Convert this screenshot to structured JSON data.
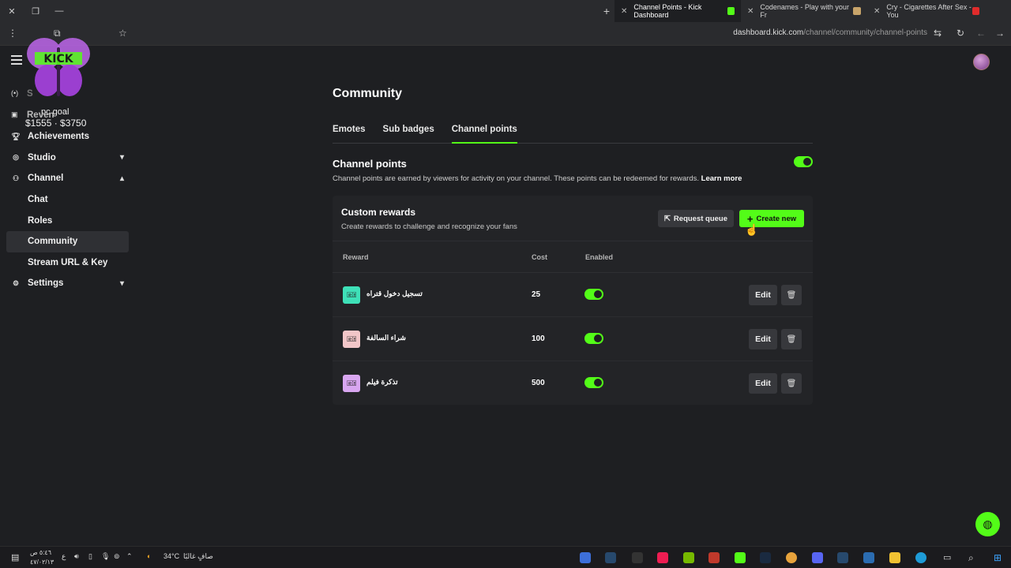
{
  "browser": {
    "tabs": [
      {
        "title": "Channel Points - Kick Dashboard",
        "active": true,
        "fav_color": "#53fc18"
      },
      {
        "title": "Codenames - Play with your Fr",
        "active": false,
        "fav_color": "#c8a46a"
      },
      {
        "title": "Cry - Cigarettes After Sex - You",
        "active": false,
        "fav_color": "#e02b2b"
      }
    ],
    "url_host": "dashboard.kick.com",
    "url_path": "/channel/community/channel-points"
  },
  "overlay": {
    "goal_label": "pc goal",
    "goal_values": "$1555 · $3750"
  },
  "sidebar": {
    "items": [
      {
        "label": "Achievements",
        "icon": "trophy-icon"
      },
      {
        "label": "Studio",
        "icon": "studio-icon"
      },
      {
        "label": "Channel",
        "icon": "channel-icon"
      },
      {
        "label": "Chat"
      },
      {
        "label": "Roles"
      },
      {
        "label": "Community"
      },
      {
        "label": "Stream URL & Key"
      },
      {
        "label": "Settings",
        "icon": "gear-icon"
      }
    ],
    "partial_items": [
      "S",
      "Reven"
    ]
  },
  "page": {
    "title": "Community",
    "tabs": [
      "Emotes",
      "Sub badges",
      "Channel points"
    ],
    "channel_points": {
      "title": "Channel points",
      "description": "Channel points are earned by viewers for activity on your channel. These points can be redeemed for rewards.",
      "learn_more": "Learn more",
      "enabled": true
    },
    "custom_rewards": {
      "title": "Custom rewards",
      "subtitle": "Create rewards to challenge and recognize your fans",
      "request_queue_label": "Request queue",
      "create_new_label": "Create new",
      "columns": [
        "Reward",
        "Cost",
        "Enabled"
      ],
      "rows": [
        {
          "name": "تسجيل دخول قتراه",
          "cost": "25",
          "enabled": true,
          "icon_color": "#3ee0b8",
          "edit": "Edit"
        },
        {
          "name": "شراء السالفة",
          "cost": "100",
          "enabled": true,
          "icon_color": "#f2c6c8",
          "edit": "Edit"
        },
        {
          "name": "تذكرة فيلم",
          "cost": "500",
          "enabled": true,
          "icon_color": "#d8a6f0",
          "edit": "Edit"
        }
      ]
    }
  },
  "taskbar": {
    "time": "٥:٤٦ ص",
    "date": "٤٧/٠٢/١٣",
    "lang": "ع",
    "temp": "34°C",
    "weather": "صافٍ غالبًا"
  },
  "colors": {
    "accent": "#53fc18",
    "bg": "#1e1f22"
  }
}
